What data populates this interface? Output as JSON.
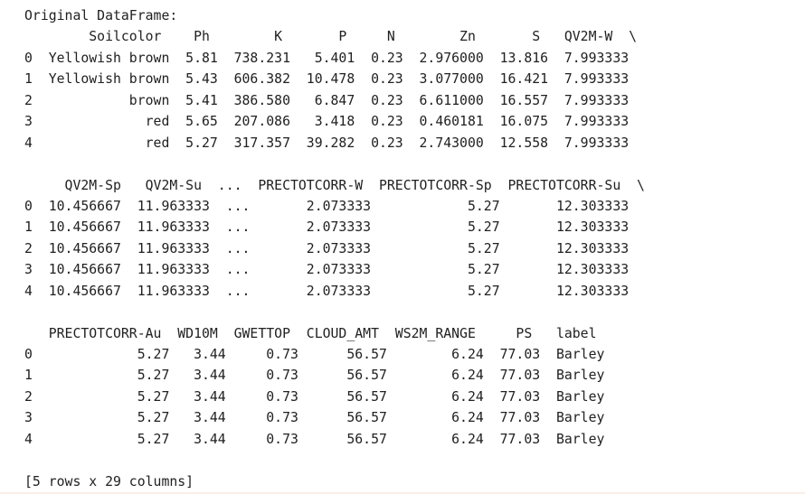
{
  "output": {
    "lines": [
      "Original DataFrame:",
      "        Soilcolor    Ph        K       P     N        Zn       S   QV2M-W  \\",
      "0  Yellowish brown  5.81  738.231   5.401  0.23  2.976000  13.816  7.993333",
      "1  Yellowish brown  5.43  606.382  10.478  0.23  3.077000  16.421  7.993333",
      "2            brown  5.41  386.580   6.847  0.23  6.611000  16.557  7.993333",
      "3              red  5.65  207.086   3.418  0.23  0.460181  16.075  7.993333",
      "4              red  5.27  317.357  39.282  0.23  2.743000  12.558  7.993333",
      "",
      "     QV2M-Sp   QV2M-Su  ...  PRECTOTCORR-W  PRECTOTCORR-Sp  PRECTOTCORR-Su  \\",
      "0  10.456667  11.963333  ...       2.073333            5.27       12.303333",
      "1  10.456667  11.963333  ...       2.073333            5.27       12.303333",
      "2  10.456667  11.963333  ...       2.073333            5.27       12.303333",
      "3  10.456667  11.963333  ...       2.073333            5.27       12.303333",
      "4  10.456667  11.963333  ...       2.073333            5.27       12.303333",
      "",
      "   PRECTOTCORR-Au  WD10M  GWETTOP  CLOUD_AMT  WS2M_RANGE     PS   label",
      "0             5.27   3.44     0.73      56.57        6.24  77.03  Barley",
      "1             5.27   3.44     0.73      56.57        6.24  77.03  Barley",
      "2             5.27   3.44     0.73      56.57        6.24  77.03  Barley",
      "3             5.27   3.44     0.73      56.57        6.24  77.03  Barley",
      "4             5.27   3.44     0.73      56.57        6.24  77.03  Barley",
      "",
      "[5 rows x 29 columns]"
    ]
  }
}
